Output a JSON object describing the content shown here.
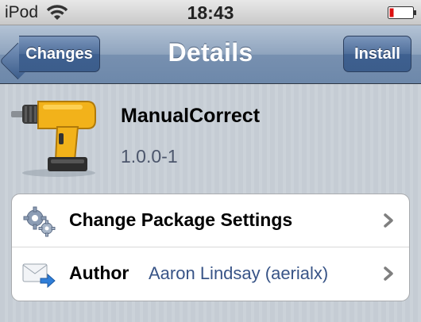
{
  "status_bar": {
    "carrier": "iPod",
    "time": "18:43"
  },
  "nav": {
    "back_label": "Changes",
    "title": "Details",
    "install_label": "Install"
  },
  "package": {
    "name": "ManualCorrect",
    "version": "1.0.0-1",
    "icon": "power-drill-icon"
  },
  "rows": [
    {
      "label": "Change Package Settings",
      "value": "",
      "icon": "gears-icon"
    },
    {
      "label": "Author",
      "value": "Aaron Lindsay (aerialx)",
      "icon": "mail-forward-icon"
    }
  ],
  "colors": {
    "nav_top": "#b4c3d5",
    "nav_bottom": "#6d88aa",
    "button": "#3c5d8b",
    "version_text": "#4c566c",
    "value_text": "#385487",
    "background": "#c5ccd4"
  }
}
